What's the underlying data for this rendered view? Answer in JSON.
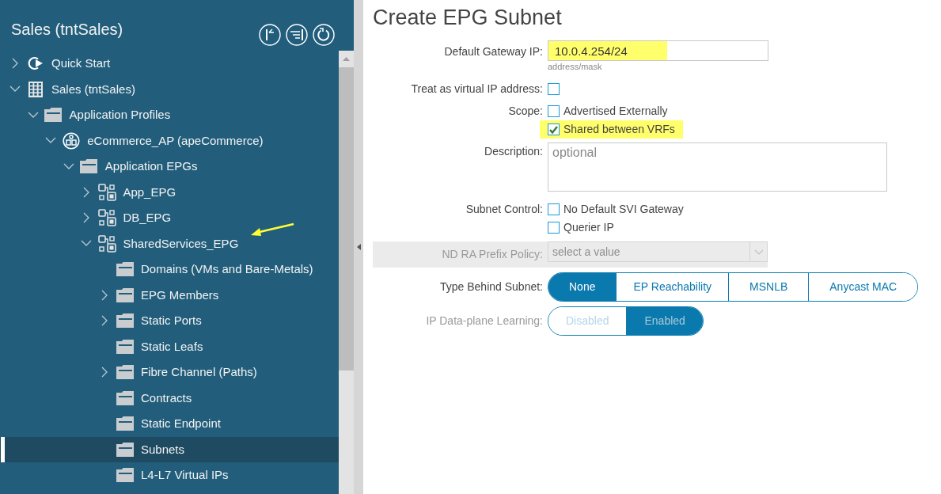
{
  "sidebar": {
    "title": "Sales (tntSales)",
    "tree": [
      {
        "label": "Quick Start",
        "kind": "quickstart",
        "expandable": true,
        "expanded": false,
        "selected": false
      },
      {
        "label": "Sales (tntSales)",
        "kind": "tenant",
        "expandable": true,
        "expanded": true,
        "selected": false,
        "children": [
          {
            "label": "Application Profiles",
            "kind": "folder",
            "expandable": true,
            "expanded": true,
            "selected": false,
            "children": [
              {
                "label": "eCommerce_AP (apeCommerce)",
                "kind": "app-profile",
                "expandable": true,
                "expanded": true,
                "selected": false,
                "children": [
                  {
                    "label": "Application EPGs",
                    "kind": "folder",
                    "expandable": true,
                    "expanded": true,
                    "selected": false,
                    "children": [
                      {
                        "label": "App_EPG",
                        "kind": "epg",
                        "expandable": true,
                        "expanded": false,
                        "selected": false
                      },
                      {
                        "label": "DB_EPG",
                        "kind": "epg",
                        "expandable": true,
                        "expanded": false,
                        "selected": false
                      },
                      {
                        "label": "SharedServices_EPG",
                        "kind": "epg",
                        "expandable": true,
                        "expanded": true,
                        "selected": false,
                        "children": [
                          {
                            "label": "Domains (VMs and Bare-Metals)",
                            "kind": "folder",
                            "expandable": false,
                            "selected": false
                          },
                          {
                            "label": "EPG Members",
                            "kind": "folder",
                            "expandable": true,
                            "expanded": false,
                            "selected": false
                          },
                          {
                            "label": "Static Ports",
                            "kind": "folder",
                            "expandable": true,
                            "expanded": false,
                            "selected": false
                          },
                          {
                            "label": "Static Leafs",
                            "kind": "folder",
                            "expandable": false,
                            "selected": false
                          },
                          {
                            "label": "Fibre Channel (Paths)",
                            "kind": "folder",
                            "expandable": true,
                            "expanded": false,
                            "selected": false
                          },
                          {
                            "label": "Contracts",
                            "kind": "folder",
                            "expandable": false,
                            "selected": false
                          },
                          {
                            "label": "Static Endpoint",
                            "kind": "folder",
                            "expandable": false,
                            "selected": false
                          },
                          {
                            "label": "Subnets",
                            "kind": "folder",
                            "expandable": false,
                            "selected": true
                          },
                          {
                            "label": "L4-L7 Virtual IPs",
                            "kind": "folder",
                            "expandable": false,
                            "selected": false
                          }
                        ]
                      }
                    ]
                  }
                ]
              }
            ]
          }
        ]
      }
    ]
  },
  "form": {
    "title": "Create EPG Subnet",
    "fields": [
      {
        "kind": "text",
        "label": "Default Gateway IP:",
        "value": "10.0.4.254/24",
        "hint": "address/mask",
        "highlighted": true
      },
      {
        "kind": "checks",
        "label": "Treat as virtual IP address:",
        "options": [
          {
            "checked": false,
            "highlighted": false
          }
        ]
      },
      {
        "kind": "checks",
        "label": "Scope:",
        "options": [
          {
            "label": "Advertised Externally",
            "checked": false,
            "highlighted": false
          },
          {
            "label": "Shared between VRFs",
            "checked": true,
            "highlighted": true
          }
        ]
      },
      {
        "kind": "textarea",
        "label": "Description:",
        "placeholder": "optional"
      },
      {
        "kind": "checks",
        "label": "Subnet Control:",
        "options": [
          {
            "label": "No Default SVI Gateway",
            "checked": false,
            "highlighted": false
          },
          {
            "label": "Querier IP",
            "checked": false,
            "highlighted": false
          }
        ]
      },
      {
        "kind": "select",
        "label": "ND RA Prefix Policy:",
        "placeholder": "select a value",
        "disabled": true
      },
      {
        "kind": "segmented",
        "label": "Type Behind Subnet:",
        "disabled": false,
        "options": [
          {
            "label": "None",
            "selected": true
          },
          {
            "label": "EP Reachability",
            "selected": false
          },
          {
            "label": "MSNLB",
            "selected": false
          },
          {
            "label": "Anycast MAC",
            "selected": false
          }
        ]
      },
      {
        "kind": "segmented",
        "label": "IP Data-plane Learning:",
        "disabled": true,
        "options": [
          {
            "label": "Disabled",
            "selected": false
          },
          {
            "label": "Enabled",
            "selected": true
          }
        ]
      }
    ]
  }
}
